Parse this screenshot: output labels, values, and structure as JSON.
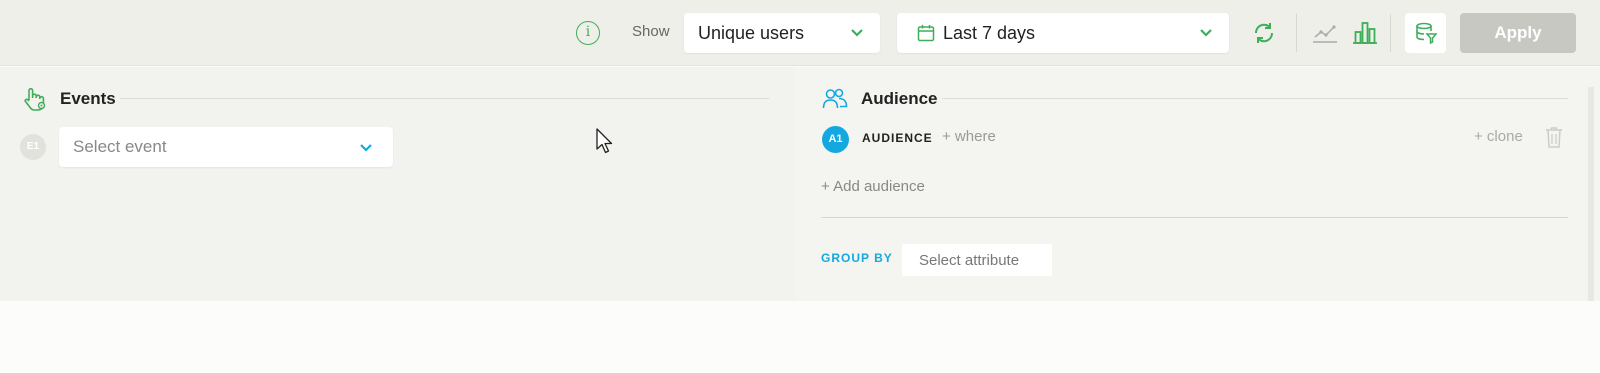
{
  "toolbar": {
    "show_label": "Show",
    "metric_value": "Unique users",
    "date_range_value": "Last 7 days",
    "apply_label": "Apply"
  },
  "events": {
    "title": "Events",
    "badge": "E1",
    "select_placeholder": "Select event"
  },
  "audience": {
    "title": "Audience",
    "badge": "A1",
    "label": "AUDIENCE",
    "where_link": "+ where",
    "clone_link": "+ clone",
    "add_audience": "+ Add audience",
    "group_by_label": "GROUP BY",
    "attribute_placeholder": "Select attribute"
  },
  "icons": [
    "info-icon",
    "calendar-icon",
    "chevron-down-icon",
    "refresh-icon",
    "line-chart-icon",
    "bar-chart-icon",
    "database-filter-icon",
    "events-touch-icon",
    "audience-users-icon",
    "trash-icon",
    "mouse-cursor"
  ],
  "colors": {
    "accent_green": "#3fae5a",
    "accent_blue": "#13a9e0",
    "apply_disabled": "#c8c8c3"
  }
}
